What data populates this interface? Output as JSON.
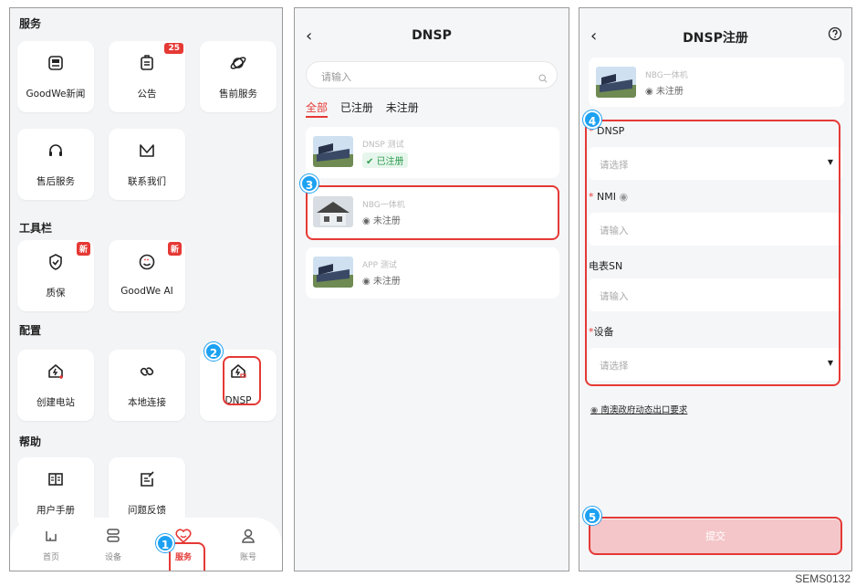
{
  "panel1": {
    "sections": {
      "service": "服务",
      "toolbar": "工具栏",
      "config": "配置",
      "help": "帮助"
    },
    "tiles": {
      "news": "GoodWe新闻",
      "notice": "公告",
      "notice_badge": "25",
      "presales": "售前服务",
      "aftersales": "售后服务",
      "contact": "联系我们",
      "warranty": "质保",
      "warranty_badge": "新",
      "ai": "GoodWe AI",
      "ai_badge": "新",
      "create_station": "创建电站",
      "local_connect": "本地连接",
      "dnsp": "DNSP",
      "manual": "用户手册",
      "feedback": "问题反馈"
    },
    "nav": {
      "home": "首页",
      "device": "设备",
      "service": "服务",
      "account": "账号"
    }
  },
  "panel2": {
    "title": "DNSP",
    "search_placeholder": "请输入",
    "filters": [
      "全部",
      "已注册",
      "未注册"
    ],
    "cards": [
      {
        "name": "DNSP 测试",
        "status": "已注册"
      },
      {
        "name": "NBG一体机",
        "status": "未注册"
      },
      {
        "name": "APP 测试",
        "status": "未注册"
      }
    ]
  },
  "panel3": {
    "title": "DNSP注册",
    "station_name": "NBG一体机",
    "station_status": "未注册",
    "fields": {
      "dnsp_label": "DNSP",
      "dnsp_placeholder": "请选择",
      "nmi_label": "NMI",
      "nmi_placeholder": "请输入",
      "sn_label": "电表SN",
      "sn_placeholder": "请输入",
      "device_label": "设备",
      "device_placeholder": "请选择"
    },
    "link": "南澳政府动态出口要求",
    "submit": "提交"
  },
  "steps": [
    "1",
    "2",
    "3",
    "4",
    "5"
  ],
  "caption": "SEMS0132",
  "colors": {
    "accent": "#e53935",
    "step": "#1da1f2",
    "success": "#2e9b4f"
  }
}
